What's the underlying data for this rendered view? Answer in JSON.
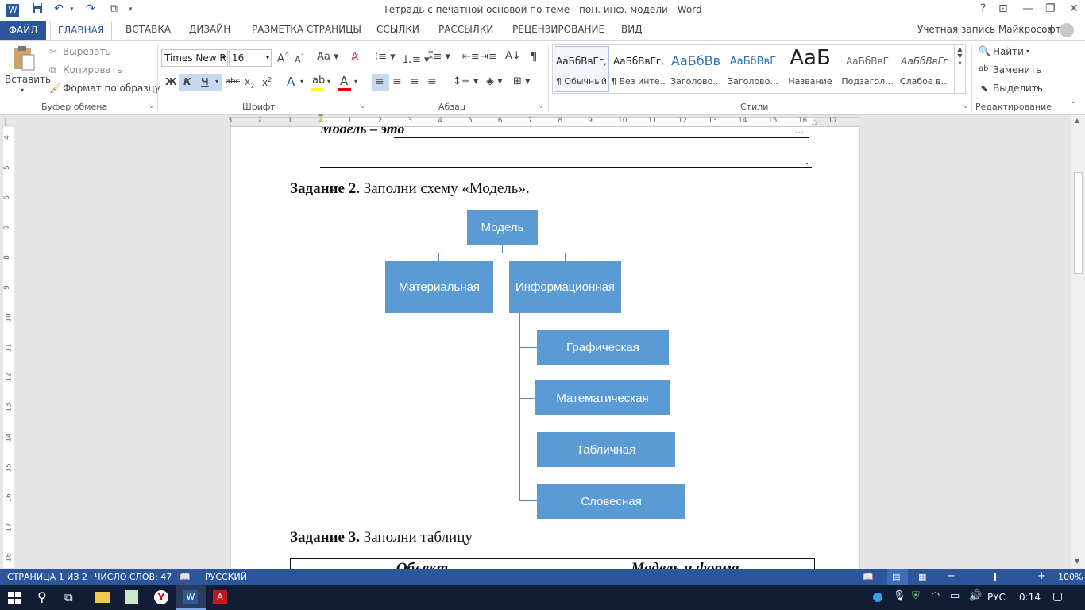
{
  "window": {
    "title": "Тетрадь с печатной основой по теме - пон. инф. модели - Word",
    "account": "Учетная запись Майкрософт"
  },
  "tabs": [
    "ФАЙЛ",
    "ГЛАВНАЯ",
    "ВСТАВКА",
    "ДИЗАЙН",
    "РАЗМЕТКА СТРАНИЦЫ",
    "ССЫЛКИ",
    "РАССЫЛКИ",
    "РЕЦЕНЗИРОВАНИЕ",
    "ВИД"
  ],
  "clipboard": {
    "paste": "Вставить",
    "cut": "Вырезать",
    "copy": "Копировать",
    "format_painter": "Формат по образцу",
    "label": "Буфер обмена"
  },
  "font": {
    "name": "Times New R",
    "size": "16",
    "bold": "Ж",
    "italic": "К",
    "underline": "Ч",
    "strike": "abc",
    "label": "Шрифт"
  },
  "paragraph": {
    "label": "Абзац"
  },
  "styles": {
    "label": "Стили",
    "items": [
      {
        "preview": "АаБбВвГг,",
        "name": "¶ Обычный"
      },
      {
        "preview": "АаБбВвГг,",
        "name": "¶ Без инте..."
      },
      {
        "preview": "АаБбВв",
        "name": "Заголово..."
      },
      {
        "preview": "АаБбВвГ",
        "name": "Заголово..."
      },
      {
        "preview": "АаБ",
        "name": "Название"
      },
      {
        "preview": "АаБбВвГ",
        "name": "Подзагол..."
      },
      {
        "preview": "АаБбВвГг",
        "name": "Слабое в..."
      }
    ]
  },
  "editing": {
    "find": "Найти",
    "replace": "Заменить",
    "select": "Выделить",
    "label": "Редактирование"
  },
  "ruler": {
    "h_numbers": [
      "3",
      "2",
      "1",
      "1",
      "2",
      "3",
      "4",
      "5",
      "6",
      "7",
      "8",
      "9",
      "10",
      "11",
      "12",
      "13",
      "14",
      "15",
      "16",
      "17"
    ],
    "v_numbers": [
      "4",
      "5",
      "6",
      "7",
      "8",
      "9",
      "10",
      "11",
      "12",
      "13",
      "14",
      "15",
      "16",
      "17",
      "18"
    ]
  },
  "document": {
    "top_line_text": "Модель – это",
    "top_line_end": "...",
    "second_line_end": ".",
    "task2_bold": "Задание 2.",
    "task2_text": " Заполни схему «Модель».",
    "task3_bold": "Задание 3.",
    "task3_text": " Заполни таблицу",
    "table_headers": [
      "Объект",
      "Модель и форма"
    ],
    "diagram": {
      "root": "Модель",
      "level1": [
        "Материальная",
        "Информационная"
      ],
      "level2": [
        "Графическая",
        "Математическая",
        "Табличная",
        "Словесная"
      ]
    }
  },
  "status": {
    "page": "СТРАНИЦА 1 ИЗ 2",
    "words": "ЧИСЛО СЛОВ: 47",
    "language": "РУССКИЙ",
    "zoom": "100%"
  },
  "taskbar": {
    "lang": "РУС",
    "time": "0:14"
  }
}
